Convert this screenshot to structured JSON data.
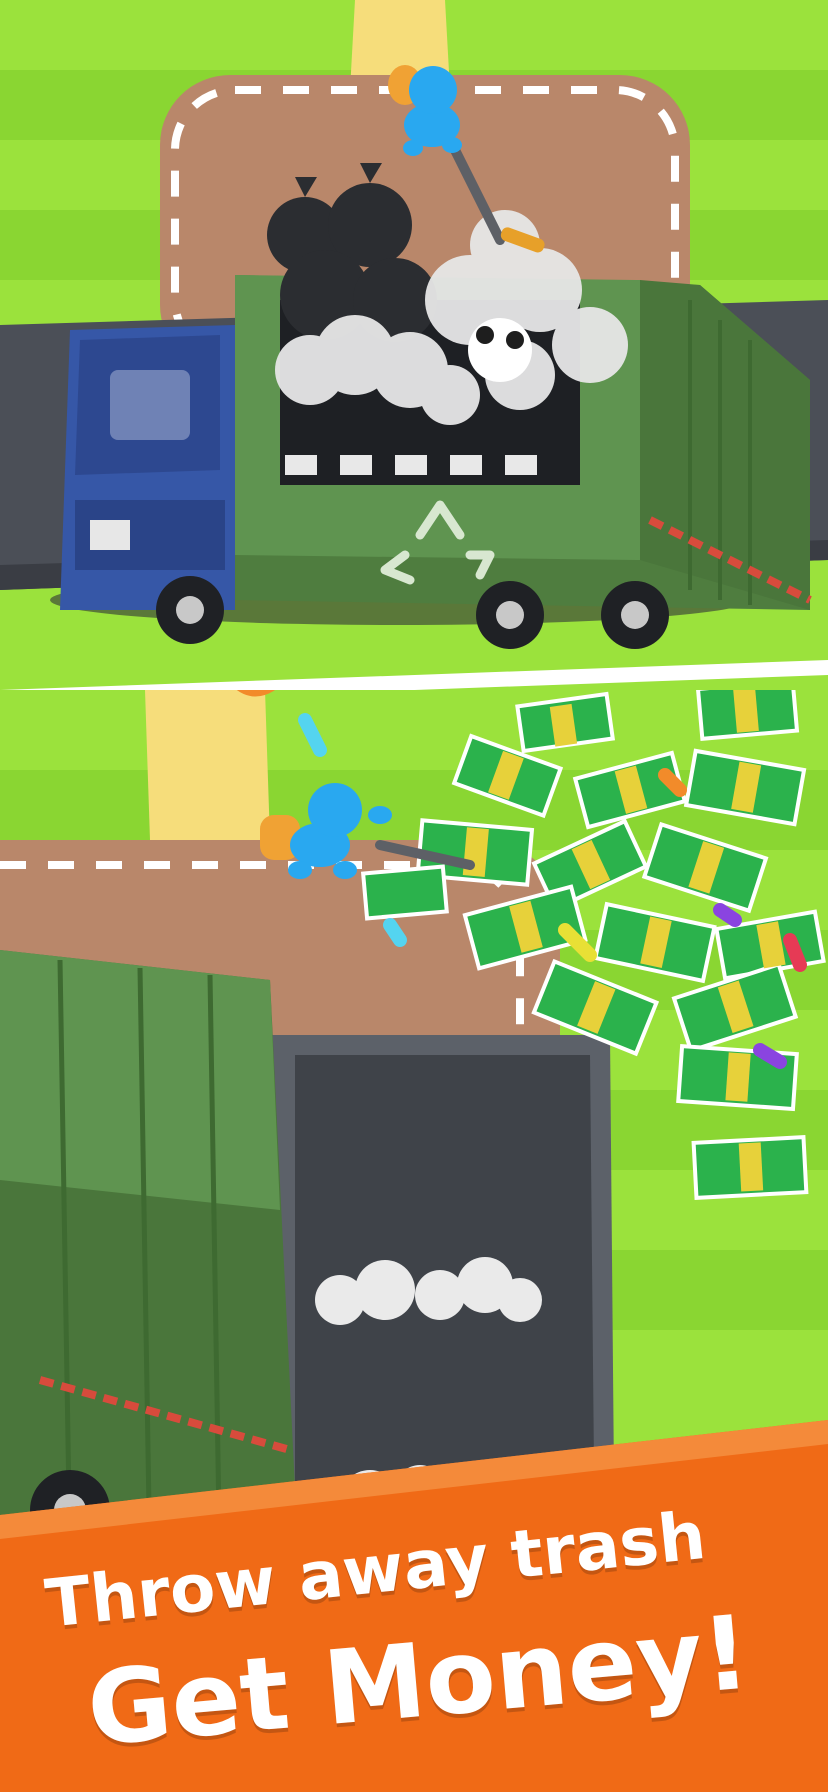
{
  "screen": {
    "caption": {
      "line1": "Throw away trash",
      "line2": "Get Money!"
    }
  },
  "colors": {
    "grass_light": "#9be23c",
    "grass_dark": "#86d230",
    "dirt": "#b9876a",
    "road": "#4b4f57",
    "truck_body": "#5a8a4a",
    "truck_cab": "#3b5fb0",
    "player": "#29a8f0",
    "backpack": "#f0a234",
    "cash": "#2bb24c",
    "banner": "#f06a16"
  },
  "icons": {
    "recycle": "recycle-icon",
    "trash_bag": "trash-bag-icon",
    "cash_bundle": "cash-bundle-icon"
  }
}
